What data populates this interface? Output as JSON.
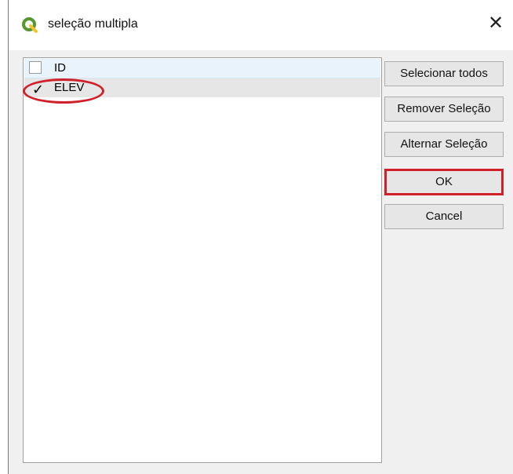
{
  "window": {
    "title": "seleção multipla",
    "close_glyph": "✕",
    "app_icon": "qgis-icon"
  },
  "list": {
    "items": [
      {
        "label": "ID",
        "checked": false
      },
      {
        "label": "ELEV",
        "checked": true
      }
    ],
    "check_glyph": "✓"
  },
  "buttons": {
    "select_all": "Selecionar todos",
    "remove_selection": "Remover Seleção",
    "toggle_selection": "Alternar Seleção",
    "ok": "OK",
    "cancel": "Cancel"
  },
  "colors": {
    "annotation": "#d0202a",
    "qgis_green": "#589632"
  }
}
